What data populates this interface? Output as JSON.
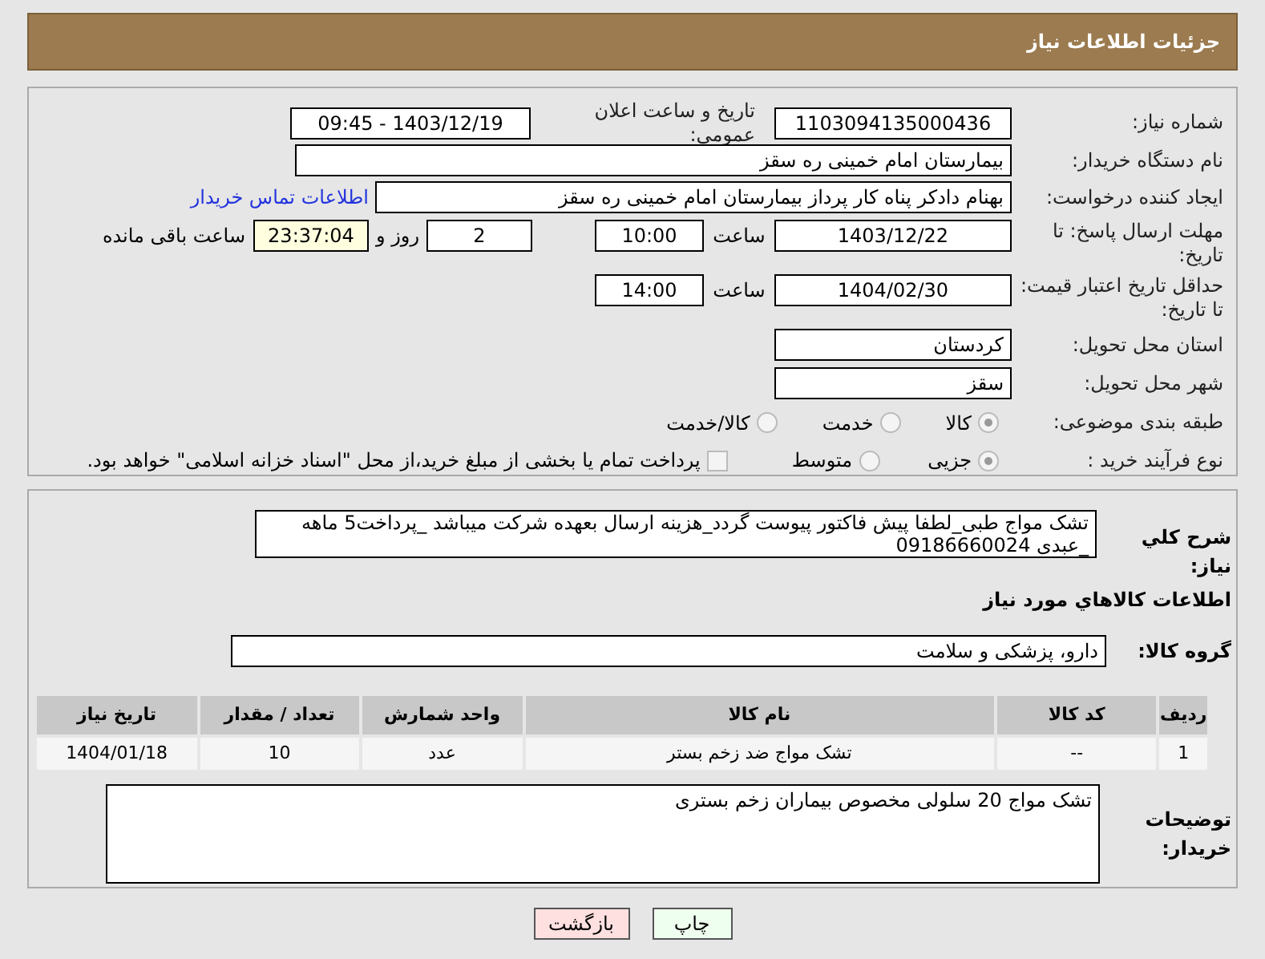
{
  "header": {
    "title": "جزئیات اطلاعات نیاز"
  },
  "need_number": {
    "label": "شماره نیاز:",
    "value": "1103094135000436"
  },
  "announce": {
    "label": "تاریخ و ساعت اعلان عمومی:",
    "value": "1403/12/19 - 09:45"
  },
  "buyer_org": {
    "label": "نام دستگاه خریدار:",
    "value": "بیمارستان امام خمینی  ره  سقز"
  },
  "requester": {
    "label": "ایجاد کننده درخواست:",
    "value": "بهنام دادکر پناه کار پرداز بیمارستان امام خمینی  ره  سقز",
    "link": "اطلاعات تماس خریدار"
  },
  "response_deadline": {
    "label": "مهلت ارسال پاسخ: تا تاریخ:",
    "date": "1403/12/22",
    "time_label": "ساعت",
    "time": "10:00",
    "days": "2",
    "days_label": "روز و",
    "remaining": "23:37:04",
    "remaining_label": "ساعت باقی مانده"
  },
  "price_validity": {
    "label": "حداقل تاریخ اعتبار قیمت: تا تاریخ:",
    "date": "1404/02/30",
    "time_label": "ساعت",
    "time": "14:00"
  },
  "province": {
    "label": "استان محل تحویل:",
    "value": "کردستان"
  },
  "city": {
    "label": "شهر محل تحویل:",
    "value": "سقز"
  },
  "category": {
    "label": "طبقه بندی موضوعی:",
    "options": [
      {
        "label": "کالا",
        "selected": true
      },
      {
        "label": "خدمت",
        "selected": false
      },
      {
        "label": "کالا/خدمت",
        "selected": false
      }
    ]
  },
  "purchase_type": {
    "label": "نوع فرآیند خرید :",
    "options": [
      {
        "label": "جزیی",
        "selected": true
      },
      {
        "label": "متوسط",
        "selected": false
      }
    ],
    "checkbox": {
      "label": "پرداخت تمام یا بخشی از مبلغ خرید،از محل \"اسناد خزانه اسلامی\" خواهد بود.",
      "checked": false
    }
  },
  "description": {
    "label": "شرح کلي نياز:",
    "value": "تشک مواج طبی_لطفا پیش فاکتور  پیوست گردد_هزینه ارسال بعهده شرکت میباشد _پرداخت5 ماهه _عبدی 09186660024"
  },
  "goods_title": "اطلاعات کالاهاي مورد نياز",
  "goods_group": {
    "label": "گروه کالا:",
    "value": "دارو، پزشکی و سلامت"
  },
  "table": {
    "columns": [
      "ردیف",
      "کد کالا",
      "نام کالا",
      "واحد شمارش",
      "تعداد / مقدار",
      "تاریخ نیاز"
    ],
    "rows": [
      [
        "1",
        "--",
        "تشک مواج ضد زخم بستر",
        "عدد",
        "10",
        "1404/01/18"
      ]
    ]
  },
  "buyer_notes": {
    "label": "توضیحات خریدار:",
    "value": "تشک مواج 20 سلولی مخصوص بیماران زخم بستری"
  },
  "buttons": [
    {
      "label": "چاپ",
      "kind": "print"
    },
    {
      "label": "بازگشت",
      "kind": "back"
    }
  ]
}
